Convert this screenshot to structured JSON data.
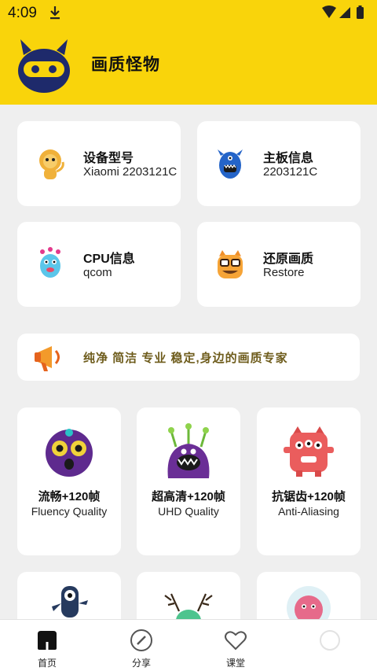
{
  "status_bar": {
    "time": "4:09"
  },
  "header": {
    "title": "画质怪物"
  },
  "info_cards": [
    {
      "title": "设备型号",
      "value": "Xiaomi 2203121C",
      "icon": "lion-monster-icon"
    },
    {
      "title": "主板信息",
      "value": "2203121C",
      "icon": "blue-monster-icon"
    },
    {
      "title": "CPU信息",
      "value": "qcom",
      "icon": "balloon-monster-icon"
    },
    {
      "title": "还原画质",
      "value": "Restore",
      "icon": "glasses-monster-icon"
    }
  ],
  "banner": {
    "text": "纯净 简洁 专业 稳定,身边的画质专家",
    "icon": "megaphone-icon"
  },
  "modes": [
    {
      "title": "流畅+120帧",
      "subtitle": "Fluency Quality",
      "icon": "purple-ball-monster-icon"
    },
    {
      "title": "超高清+120帧",
      "subtitle": "UHD Quality",
      "icon": "purple-antenna-monster-icon"
    },
    {
      "title": "抗锯齿+120帧",
      "subtitle": "Anti-Aliasing",
      "icon": "red-three-eyed-monster-icon"
    }
  ],
  "nav": {
    "items": [
      {
        "label": "首页",
        "icon": "home-icon"
      },
      {
        "label": "分享",
        "icon": "compass-icon"
      },
      {
        "label": "课堂",
        "icon": "heart-icon"
      }
    ]
  }
}
